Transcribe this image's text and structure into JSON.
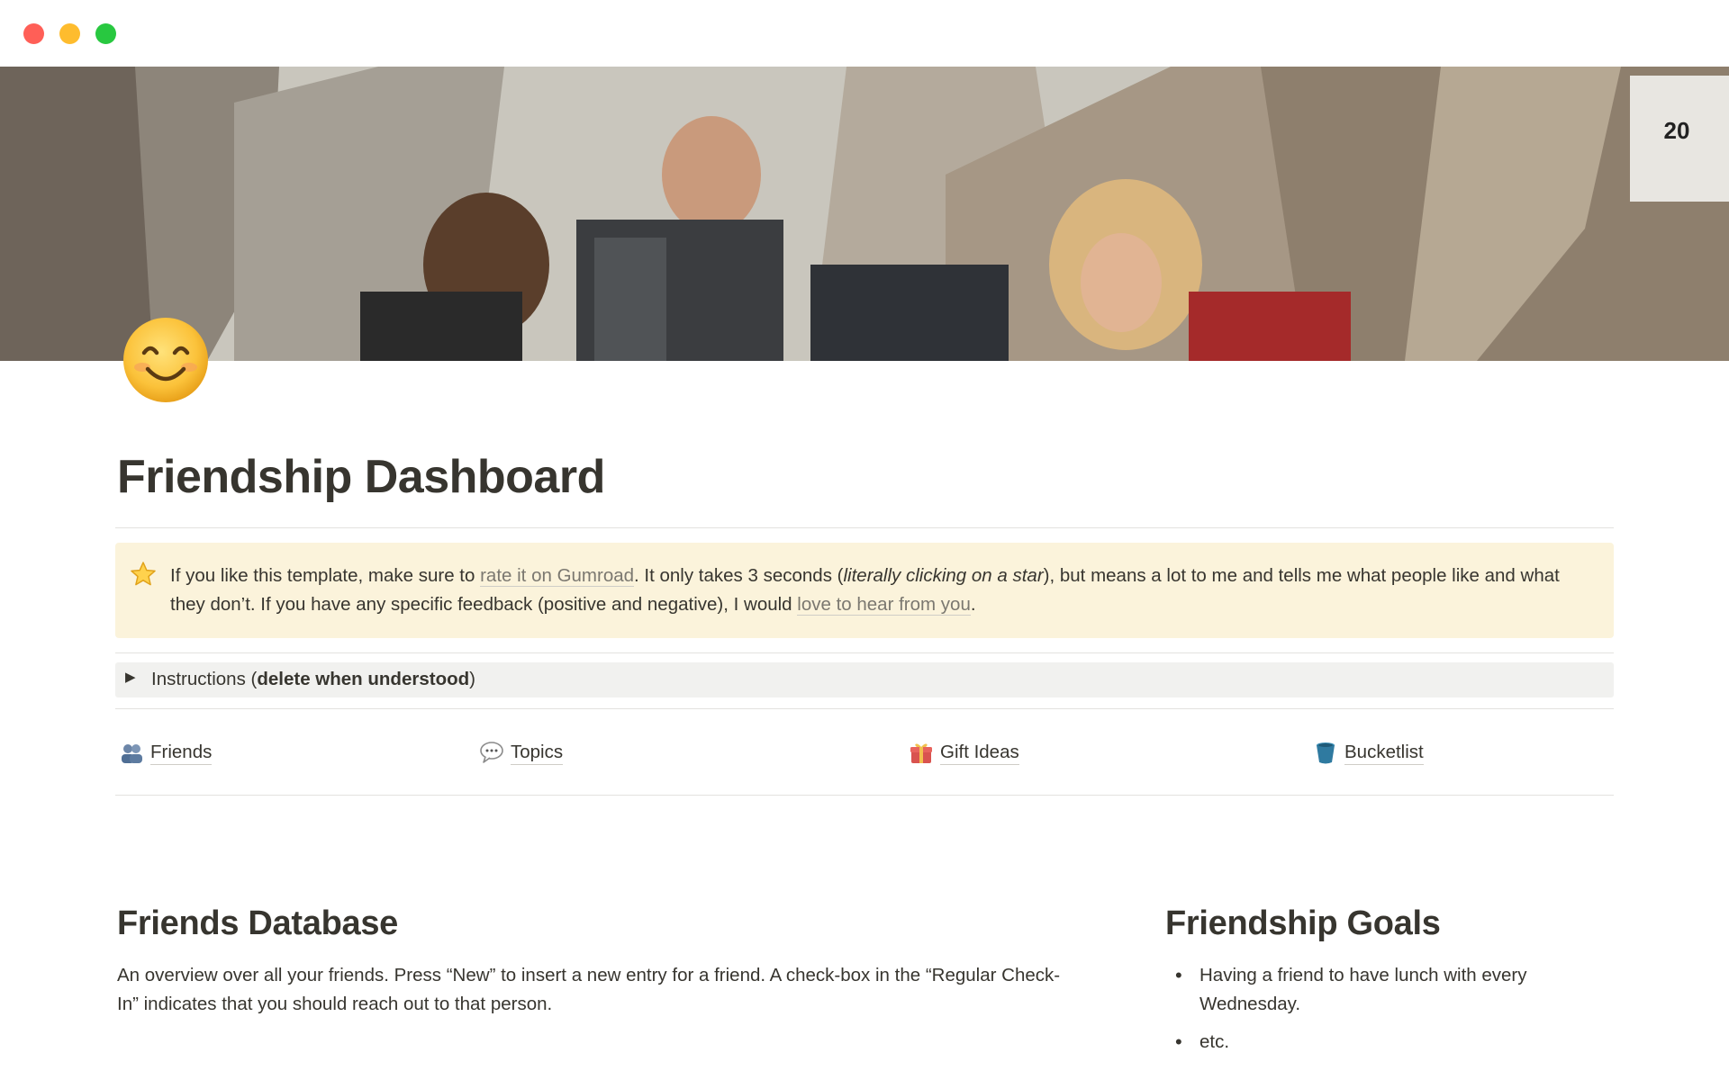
{
  "window": {
    "controls": [
      "close",
      "minimize",
      "zoom"
    ]
  },
  "cover": {
    "description_icon": "photo-cover",
    "number_sign": "20"
  },
  "page": {
    "icon": "smiling-face-icon",
    "title": "Friendship Dashboard"
  },
  "callout": {
    "icon": "star-icon",
    "text_1": "If you like this template, make sure to ",
    "link_1": "rate it on Gumroad",
    "text_2": ". It only takes 3 seconds (",
    "italic": "literally clicking on a star",
    "text_3": "), but means a lot to me and tells me what people like and what they don’t. If you have any specific feedback (positive and negative), I would ",
    "link_2": "love to hear from you",
    "text_4": "."
  },
  "toggle": {
    "label_prefix": "Instructions (",
    "label_bold": "delete when understood",
    "label_suffix": ")"
  },
  "nav": [
    {
      "label": "Friends",
      "icon": "people-icon"
    },
    {
      "label": "Topics",
      "icon": "speech-bubble-icon"
    },
    {
      "label": "Gift Ideas",
      "icon": "gift-icon"
    },
    {
      "label": "Bucketlist",
      "icon": "bucket-icon"
    }
  ],
  "friends_database": {
    "heading": "Friends Database",
    "description": "An overview over all your friends. Press “New” to insert a new entry for a friend. A check-box in the “Regular Check-In” indicates that you should reach out to that person."
  },
  "friendship_goals": {
    "heading": "Friendship Goals",
    "items": [
      "Having a friend to have lunch with every Wednesday.",
      "etc."
    ]
  },
  "colors": {
    "text": "#37352f",
    "callout_bg": "#fbf3db",
    "toggle_bg": "#f1f1ef",
    "divider": "#e3e2df",
    "link": "#7b7870"
  }
}
